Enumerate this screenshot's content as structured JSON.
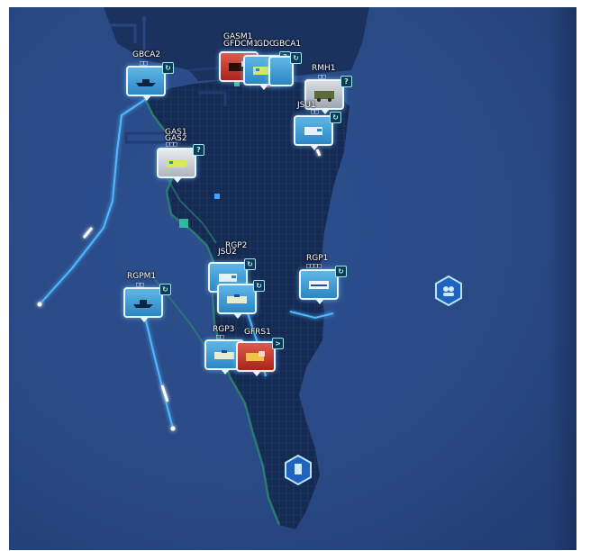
{
  "map": {
    "units": [
      {
        "id": "gbca2",
        "label": "GBCA2",
        "dots": "□□",
        "badge": "↻",
        "style": "blue",
        "vehicle": "boat-icon"
      },
      {
        "id": "gasm1",
        "label": "GASM1",
        "dots": "",
        "badge": "",
        "style": "red",
        "vehicle": "fire-truck-icon"
      },
      {
        "id": "gfdcm1",
        "label": "GFDCM1",
        "dots": "□□",
        "badge": "?",
        "style": "blue",
        "vehicle": "ambulance-icon"
      },
      {
        "id": "gdc",
        "label": "GDC",
        "dots": "",
        "badge": "",
        "style": "blue",
        "vehicle": "van-icon"
      },
      {
        "id": "gbca1",
        "label": "GBCA1",
        "dots": "",
        "badge": "↻",
        "style": "blue",
        "vehicle": "boat-icon"
      },
      {
        "id": "rmh1",
        "label": "RMH1",
        "dots": "□□",
        "badge": "?",
        "style": "grey",
        "vehicle": "military-truck-icon"
      },
      {
        "id": "jsu1",
        "label": "JSU1",
        "dots": "□□",
        "badge": "↻",
        "style": "blue",
        "vehicle": "van-icon"
      },
      {
        "id": "gas1",
        "label": "GAS1",
        "dots": "□□□",
        "badge": "?",
        "style": "yellowbg",
        "vehicle": "ambulance-icon"
      },
      {
        "id": "gas2",
        "label": "GAS2",
        "dots": "",
        "badge": "",
        "style": "yellowbg",
        "vehicle": "ambulance-icon"
      },
      {
        "id": "rgp2",
        "label": "RGP2",
        "dots": "",
        "badge": "↻",
        "style": "blue",
        "vehicle": "police-car-icon"
      },
      {
        "id": "jsu2",
        "label": "JSU2",
        "dots": "□□□",
        "badge": "↻",
        "style": "blue",
        "vehicle": "van-icon"
      },
      {
        "id": "rgp1",
        "label": "RGP1",
        "dots": "□□□□",
        "badge": "↻",
        "style": "blue",
        "vehicle": "police-van-icon"
      },
      {
        "id": "rgpm1",
        "label": "RGPM1",
        "dots": "□□",
        "badge": "↻",
        "style": "blue",
        "vehicle": "boat-icon"
      },
      {
        "id": "rgp3",
        "label": "RGP3",
        "dots": "□□",
        "badge": "",
        "style": "blue",
        "vehicle": "police-car-icon"
      },
      {
        "id": "gfrs1",
        "label": "GFRS1",
        "dots": "",
        "badge": ">",
        "style": "red",
        "vehicle": "fire-truck-icon"
      }
    ],
    "markers": [
      {
        "id": "hospital-marker",
        "icon": "hospital-icon"
      },
      {
        "id": "incident-marker",
        "icon": "people-icon"
      }
    ],
    "colors": {
      "sea": "#2a4a86",
      "land": "#152a52",
      "route": "#4fb8ff",
      "unit_blue": "#2b86c5",
      "unit_red": "#b32d22"
    }
  }
}
